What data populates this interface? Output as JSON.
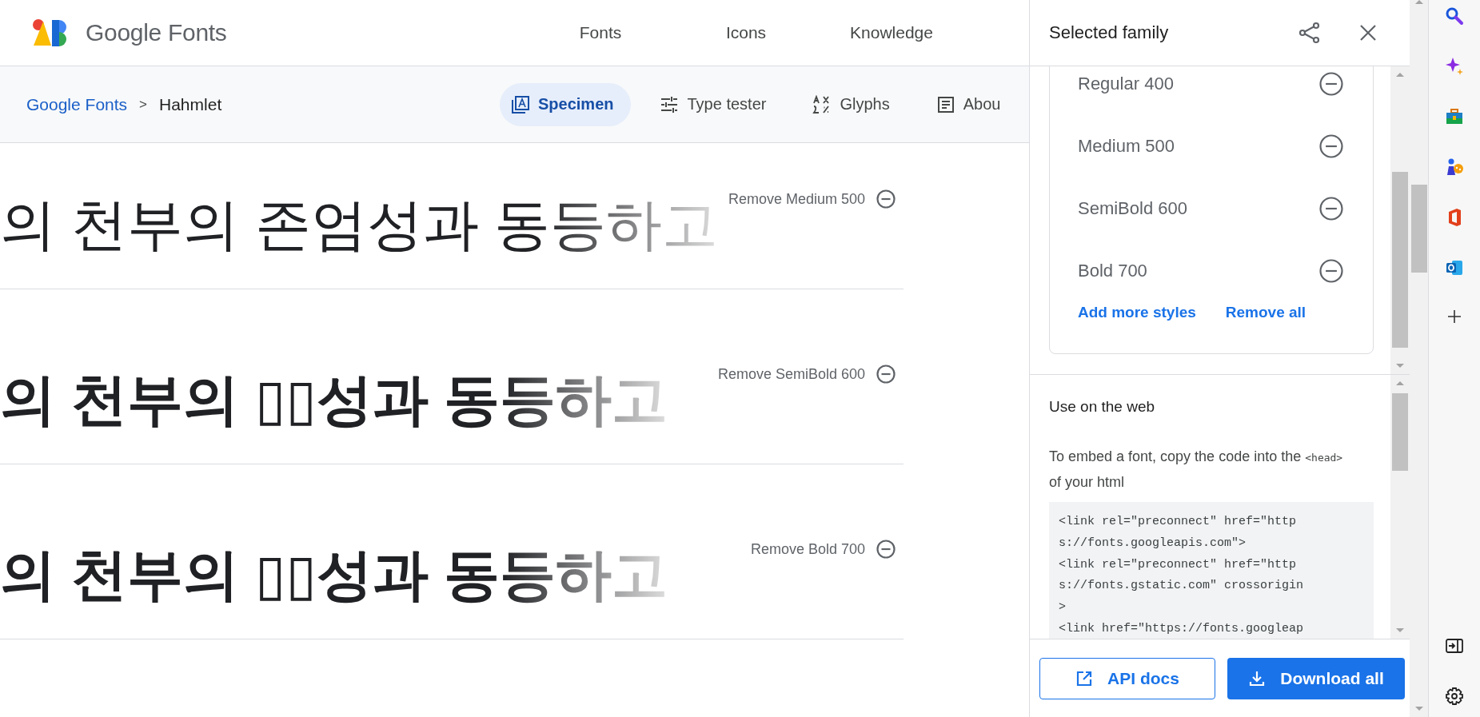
{
  "header": {
    "brand": "Google Fonts",
    "nav": [
      {
        "label": "Fonts"
      },
      {
        "label": "Icons"
      },
      {
        "label": "Knowledge"
      }
    ]
  },
  "subheader": {
    "breadcrumb": [
      {
        "label": "Google Fonts",
        "kind": "link"
      },
      {
        "label": ">",
        "kind": "separator"
      },
      {
        "label": "Hahmlet",
        "kind": "current"
      }
    ],
    "tabs": [
      {
        "label": "Specimen",
        "selected": true
      },
      {
        "label": "Type tester",
        "selected": false
      },
      {
        "label": "Glyphs",
        "selected": false
      },
      {
        "label": "Abou",
        "selected": false
      }
    ]
  },
  "specimens": [
    {
      "sample": "의 천부의 존엄성과 동등하고",
      "kind": "medium",
      "remove_label": "Remove Medium 500"
    },
    {
      "sample": "의 천부의 ▯▯성과 동등하고",
      "kind": "semibold",
      "remove_label": "Remove SemiBold 600"
    },
    {
      "sample": "의 천부의 ▯▯성과 동등하고",
      "kind": "bold",
      "remove_label": "Remove Bold 700"
    }
  ],
  "panel": {
    "title": "Selected family",
    "styles": [
      {
        "label": "Regular 400"
      },
      {
        "label": "Medium 500"
      },
      {
        "label": "SemiBold 600"
      },
      {
        "label": "Bold 700"
      }
    ],
    "links": [
      "Add more styles",
      "Remove all"
    ],
    "web": {
      "heading": "Use on the web",
      "intro": "To embed a font, copy the code into the",
      "tag": "<head>",
      "outro": "of your html",
      "code_lines": [
        "<link rel=\"preconnect\" href=\"http",
        "s://fonts.googleapis.com\">",
        "<link rel=\"preconnect\" href=\"http",
        "s://fonts.gstatic.com\" crossorigin",
        ">",
        "<link href=\"https://fonts.googleap"
      ]
    },
    "buttons": [
      {
        "label": "API docs",
        "kind": "outlined"
      },
      {
        "label": "Download all",
        "kind": "filled"
      }
    ]
  }
}
